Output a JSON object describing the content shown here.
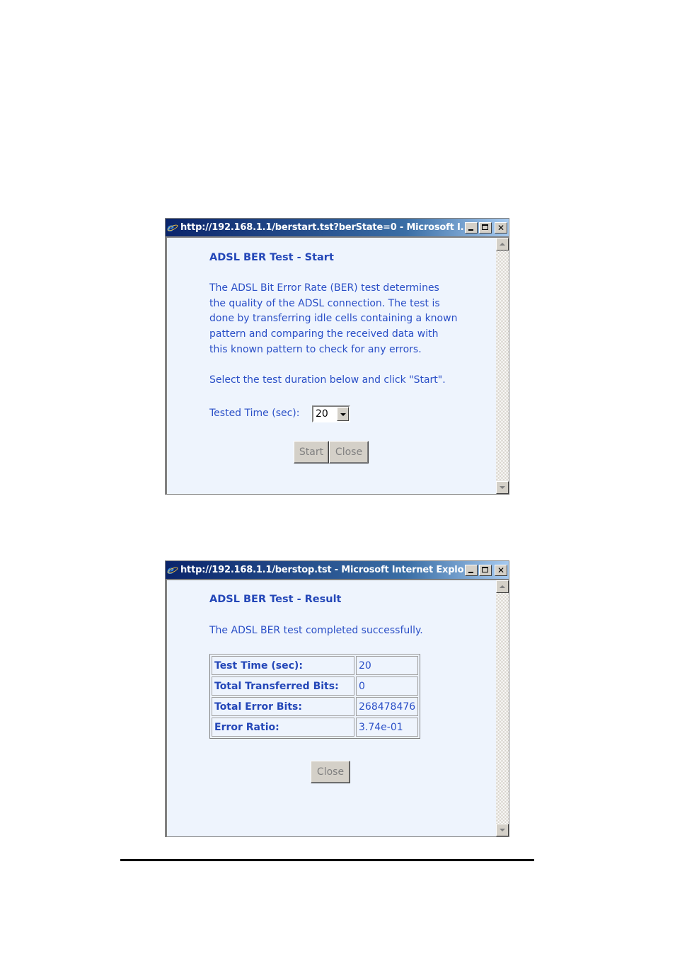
{
  "windows": [
    {
      "title": "http://192.168.1.1/berstart.tst?berState=0 - Microsoft I...",
      "heading": "ADSL BER Test - Start",
      "description_lines": [
        "The ADSL Bit Error Rate (BER) test determines",
        "the quality of the ADSL connection. The test is",
        "done by transferring idle cells containing a known",
        "pattern and comparing the received data with",
        "this known pattern to check for any errors."
      ],
      "instruction": "Select the test duration below and click \"Start\".",
      "tested_time_label": "Tested Time (sec):",
      "tested_time_value": "20",
      "start_label": "Start",
      "close_label": "Close",
      "icons": {
        "app": "ie-icon",
        "minimize": "minimize-icon",
        "maximize": "maximize-icon",
        "close": "close-icon"
      }
    },
    {
      "title": "http://192.168.1.1/berstop.tst - Microsoft Internet Explo...",
      "heading": "ADSL BER Test - Result",
      "status": "The ADSL BER test completed successfully.",
      "results": [
        {
          "label": "Test Time (sec):",
          "value": "20"
        },
        {
          "label": "Total Transferred Bits:",
          "value": "0"
        },
        {
          "label": "Total Error Bits:",
          "value": "268478476"
        },
        {
          "label": "Error Ratio:",
          "value": "3.74e-01"
        }
      ],
      "close_label": "Close"
    }
  ],
  "colors": {
    "text_blue": "#2a4fc7",
    "heading_blue": "#2447b8",
    "content_bg": "#eef4fd",
    "titlebar_start": "#0a246a",
    "titlebar_end": "#a6caf0"
  },
  "close_glyph": "✕"
}
